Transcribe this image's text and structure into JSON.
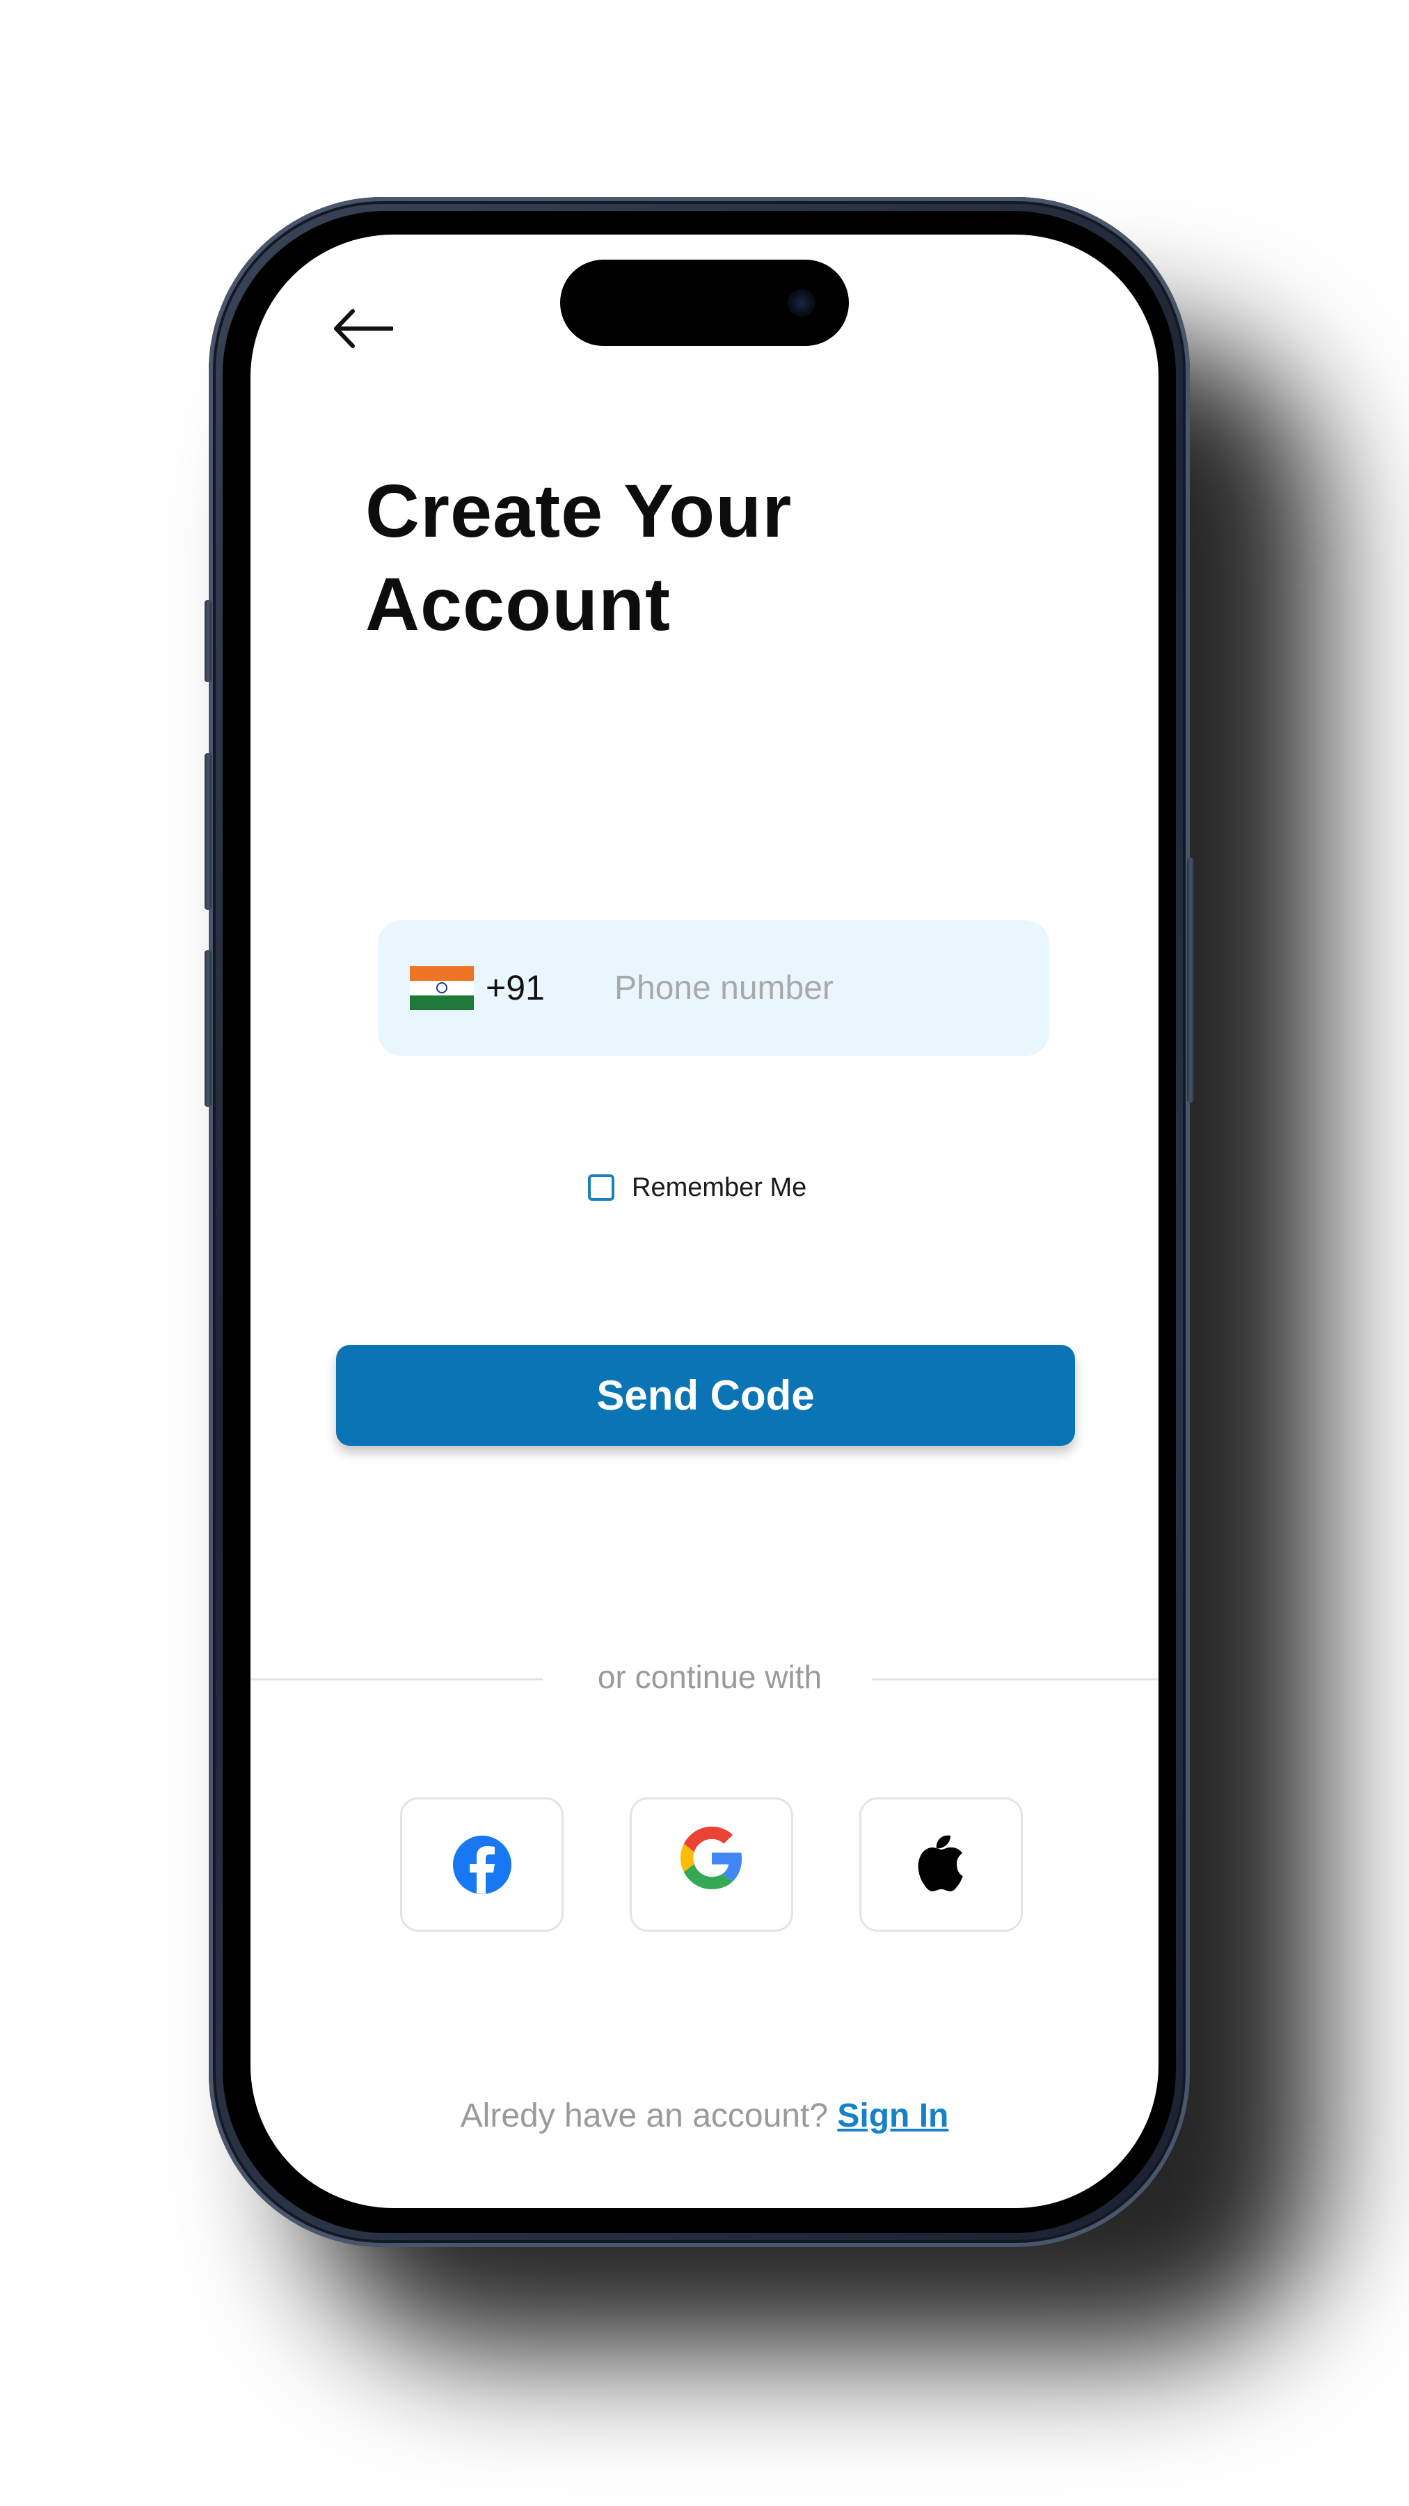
{
  "title": {
    "line1": "Create Your",
    "line2": "Account"
  },
  "phone_field": {
    "country_flag": "india-flag",
    "country_code": "+91",
    "placeholder": "Phone number",
    "value": ""
  },
  "remember_me": {
    "label": "Remember Me",
    "checked": false
  },
  "send_code_button": {
    "label": "Send Code"
  },
  "divider": {
    "text": "or continue with"
  },
  "social_buttons": [
    {
      "icon": "facebook-icon",
      "color": "#1877f2"
    },
    {
      "icon": "google-icon",
      "color": "#4285f4"
    },
    {
      "icon": "apple-icon",
      "color": "#000000"
    }
  ],
  "footer": {
    "prompt": "Alredy have an account?",
    "link": "Sign In"
  },
  "colors": {
    "primary": "#0b74b4",
    "link": "#1581c8",
    "field_background": "#eaf6fd",
    "muted_text": "#9a9a9a",
    "checkbox_border": "#1b7fbf"
  }
}
